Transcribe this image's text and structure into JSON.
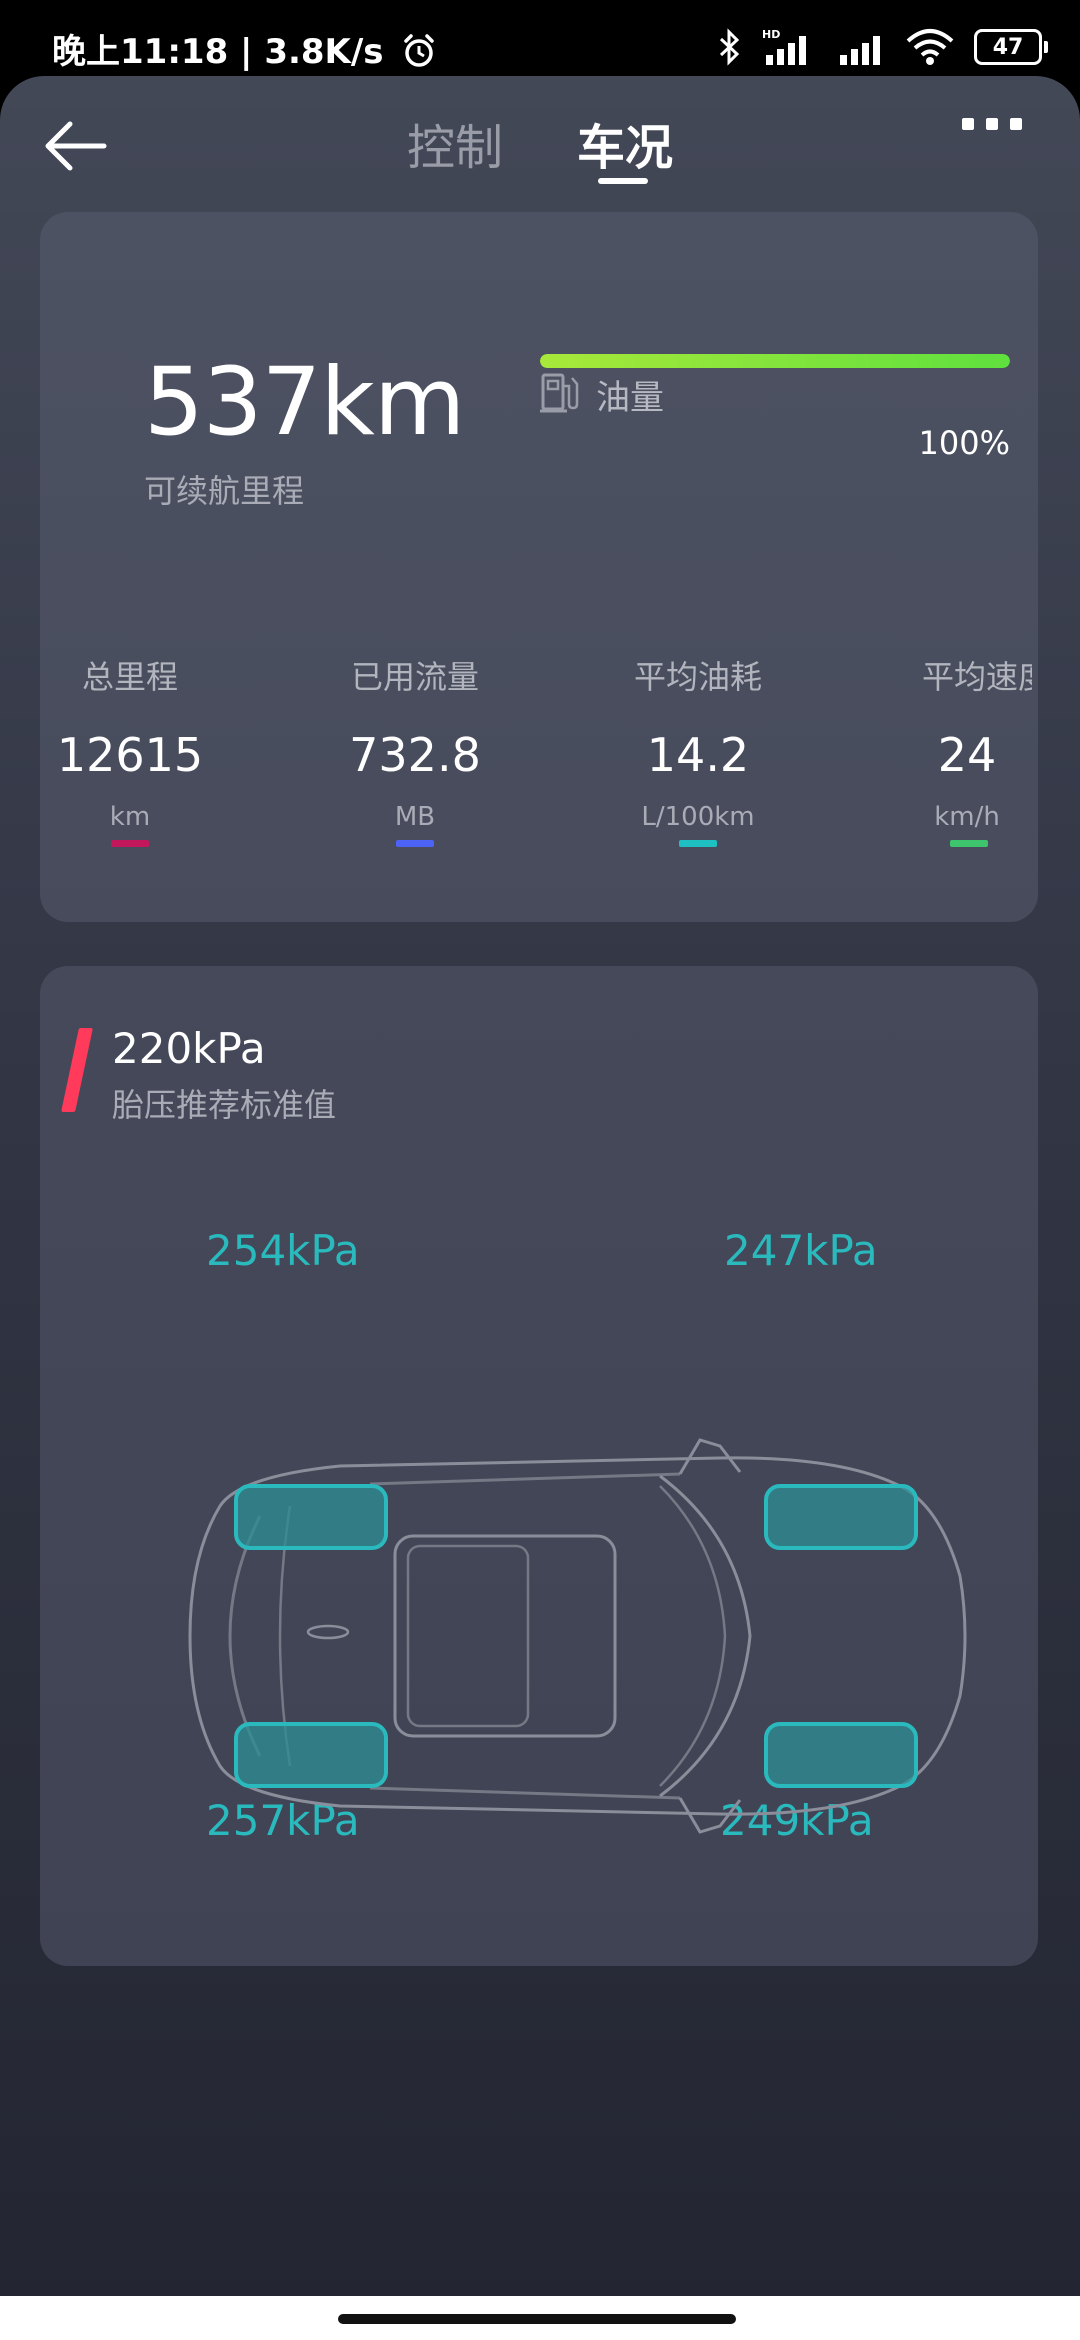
{
  "status_bar": {
    "time_net": "晚上11:18 | 3.8K/s",
    "battery": "47",
    "icons": [
      "alarm-icon",
      "bluetooth-icon",
      "hd-signal-icon",
      "signal-icon",
      "wifi-icon",
      "battery-icon"
    ]
  },
  "header": {
    "tabs": [
      {
        "label": "控制",
        "active": false
      },
      {
        "label": "车况",
        "active": true
      }
    ]
  },
  "range": {
    "value": "537km",
    "label": "可续航里程"
  },
  "fuel": {
    "label": "油量",
    "percent_text": "100%",
    "level": 1.0,
    "bar_color_start": "#a8e83a",
    "bar_color_end": "#5fe03e"
  },
  "stats": [
    {
      "label": "总里程",
      "value": "12615",
      "unit": "km",
      "color": "#c2185b"
    },
    {
      "label": "已用流量",
      "value": "732.8",
      "unit": "MB",
      "color": "#4c63f5"
    },
    {
      "label": "平均油耗",
      "value": "14.2",
      "unit": "L/100km",
      "color": "#1ec0c2"
    },
    {
      "label": "平均速度",
      "value": "24",
      "unit": "km/h",
      "color": "#3dc46c"
    }
  ],
  "tire_pressure": {
    "standard_value": "220kPa",
    "standard_label": "胎压推荐标准值",
    "front_left": "254kPa",
    "front_right": "247kPa",
    "rear_left": "257kPa",
    "rear_right": "249kPa",
    "accent": "#2ab9bd"
  }
}
